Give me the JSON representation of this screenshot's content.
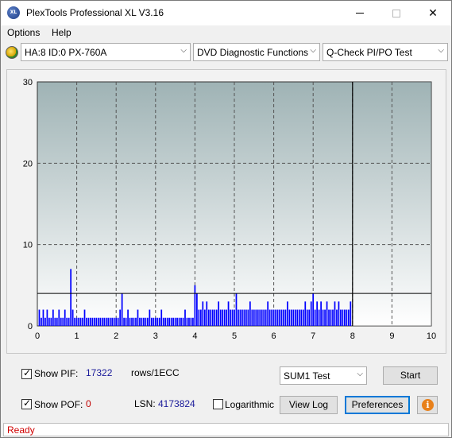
{
  "window": {
    "title": "PlexTools Professional XL V3.16",
    "logo_text": "XL"
  },
  "menu": {
    "options": "Options",
    "help": "Help"
  },
  "toolbar": {
    "drive": "HA:8 ID:0  PX-760A",
    "function": "DVD Diagnostic Functions",
    "test": "Q-Check PI/PO Test"
  },
  "chart_data": {
    "type": "bar",
    "title": "",
    "xlabel": "",
    "ylabel": "",
    "xlim": [
      0,
      10
    ],
    "ylim": [
      0,
      30
    ],
    "x_ticks": [
      "0",
      "1",
      "2",
      "3",
      "4",
      "5",
      "6",
      "7",
      "8",
      "9",
      "10"
    ],
    "y_ticks": [
      "0",
      "10",
      "20",
      "30"
    ],
    "grid": true,
    "threshold_line": 4,
    "data_end_x": 8.0,
    "colors": {
      "bars": "#0000ff",
      "plot_bg_top": "#9fb3b5",
      "plot_bg_bottom": "#ffffff",
      "empty_area": "#c8c8c8"
    },
    "series": [
      {
        "values_x": [
          0.05,
          0.1,
          0.15,
          0.2,
          0.25,
          0.3,
          0.35,
          0.4,
          0.45,
          0.5,
          0.55,
          0.6,
          0.65,
          0.7,
          0.75,
          0.8,
          0.85,
          0.9,
          0.95,
          1.0,
          1.05,
          1.1,
          1.15,
          1.2,
          1.25,
          1.3,
          1.35,
          1.4,
          1.45,
          1.5,
          1.55,
          1.6,
          1.65,
          1.7,
          1.75,
          1.8,
          1.85,
          1.9,
          1.95,
          2.0,
          2.05,
          2.1,
          2.15,
          2.2,
          2.25,
          2.3,
          2.35,
          2.4,
          2.45,
          2.5,
          2.55,
          2.6,
          2.65,
          2.7,
          2.75,
          2.8,
          2.85,
          2.9,
          2.95,
          3.0,
          3.05,
          3.1,
          3.15,
          3.2,
          3.25,
          3.3,
          3.35,
          3.4,
          3.45,
          3.5,
          3.55,
          3.6,
          3.65,
          3.7,
          3.75,
          3.8,
          3.85,
          3.9,
          3.95,
          4.0,
          4.05,
          4.1,
          4.15,
          4.2,
          4.25,
          4.3,
          4.35,
          4.4,
          4.45,
          4.5,
          4.55,
          4.6,
          4.65,
          4.7,
          4.75,
          4.8,
          4.85,
          4.9,
          4.95,
          5.0,
          5.05,
          5.1,
          5.15,
          5.2,
          5.25,
          5.3,
          5.35,
          5.4,
          5.45,
          5.5,
          5.55,
          5.6,
          5.65,
          5.7,
          5.75,
          5.8,
          5.85,
          5.9,
          5.95,
          6.0,
          6.05,
          6.1,
          6.15,
          6.2,
          6.25,
          6.3,
          6.35,
          6.4,
          6.45,
          6.5,
          6.55,
          6.6,
          6.65,
          6.7,
          6.75,
          6.8,
          6.85,
          6.9,
          6.95,
          7.0,
          7.05,
          7.1,
          7.15,
          7.2,
          7.25,
          7.3,
          7.35,
          7.4,
          7.45,
          7.5,
          7.55,
          7.6,
          7.65,
          7.7,
          7.75,
          7.8,
          7.85,
          7.9,
          7.95
        ],
        "values_y": [
          2,
          1,
          2,
          1,
          2,
          1,
          1,
          2,
          1,
          1,
          2,
          1,
          1,
          2,
          1,
          1,
          7,
          2,
          1,
          1,
          1,
          1,
          1,
          2,
          1,
          1,
          1,
          1,
          1,
          1,
          1,
          1,
          1,
          1,
          1,
          1,
          1,
          1,
          1,
          1,
          1,
          2,
          4,
          1,
          1,
          2,
          1,
          1,
          1,
          1,
          2,
          1,
          1,
          1,
          1,
          1,
          2,
          1,
          1,
          1,
          1,
          1,
          2,
          1,
          1,
          1,
          1,
          1,
          1,
          1,
          1,
          1,
          1,
          1,
          2,
          1,
          1,
          1,
          1,
          5,
          4,
          2,
          2,
          3,
          2,
          3,
          2,
          2,
          2,
          2,
          2,
          3,
          2,
          2,
          2,
          2,
          3,
          2,
          2,
          2,
          4,
          2,
          2,
          2,
          2,
          2,
          2,
          3,
          2,
          2,
          2,
          2,
          2,
          2,
          2,
          2,
          3,
          2,
          2,
          2,
          2,
          2,
          2,
          2,
          2,
          2,
          3,
          2,
          2,
          2,
          2,
          2,
          2,
          2,
          2,
          3,
          2,
          2,
          3,
          4,
          2,
          3,
          2,
          3,
          2,
          2,
          3,
          2,
          2,
          2,
          3,
          2,
          3,
          2,
          2,
          2,
          2,
          2,
          3,
          2
        ]
      }
    ]
  },
  "controls": {
    "show_pif_label": "Show PIF:",
    "show_pif_checked": true,
    "pif_value": "17322",
    "rows_label": "rows/1ECC",
    "show_pof_label": "Show POF:",
    "show_pof_checked": true,
    "pof_value": "0",
    "lsn_label": "LSN:",
    "lsn_value": "4173824",
    "logarithmic_label": "Logarithmic",
    "logarithmic_checked": false,
    "sum_test": "SUM1 Test",
    "start_button": "Start",
    "viewlog_button": "View Log",
    "preferences_button": "Preferences",
    "info_icon": "i"
  },
  "status": {
    "text": "Ready"
  }
}
